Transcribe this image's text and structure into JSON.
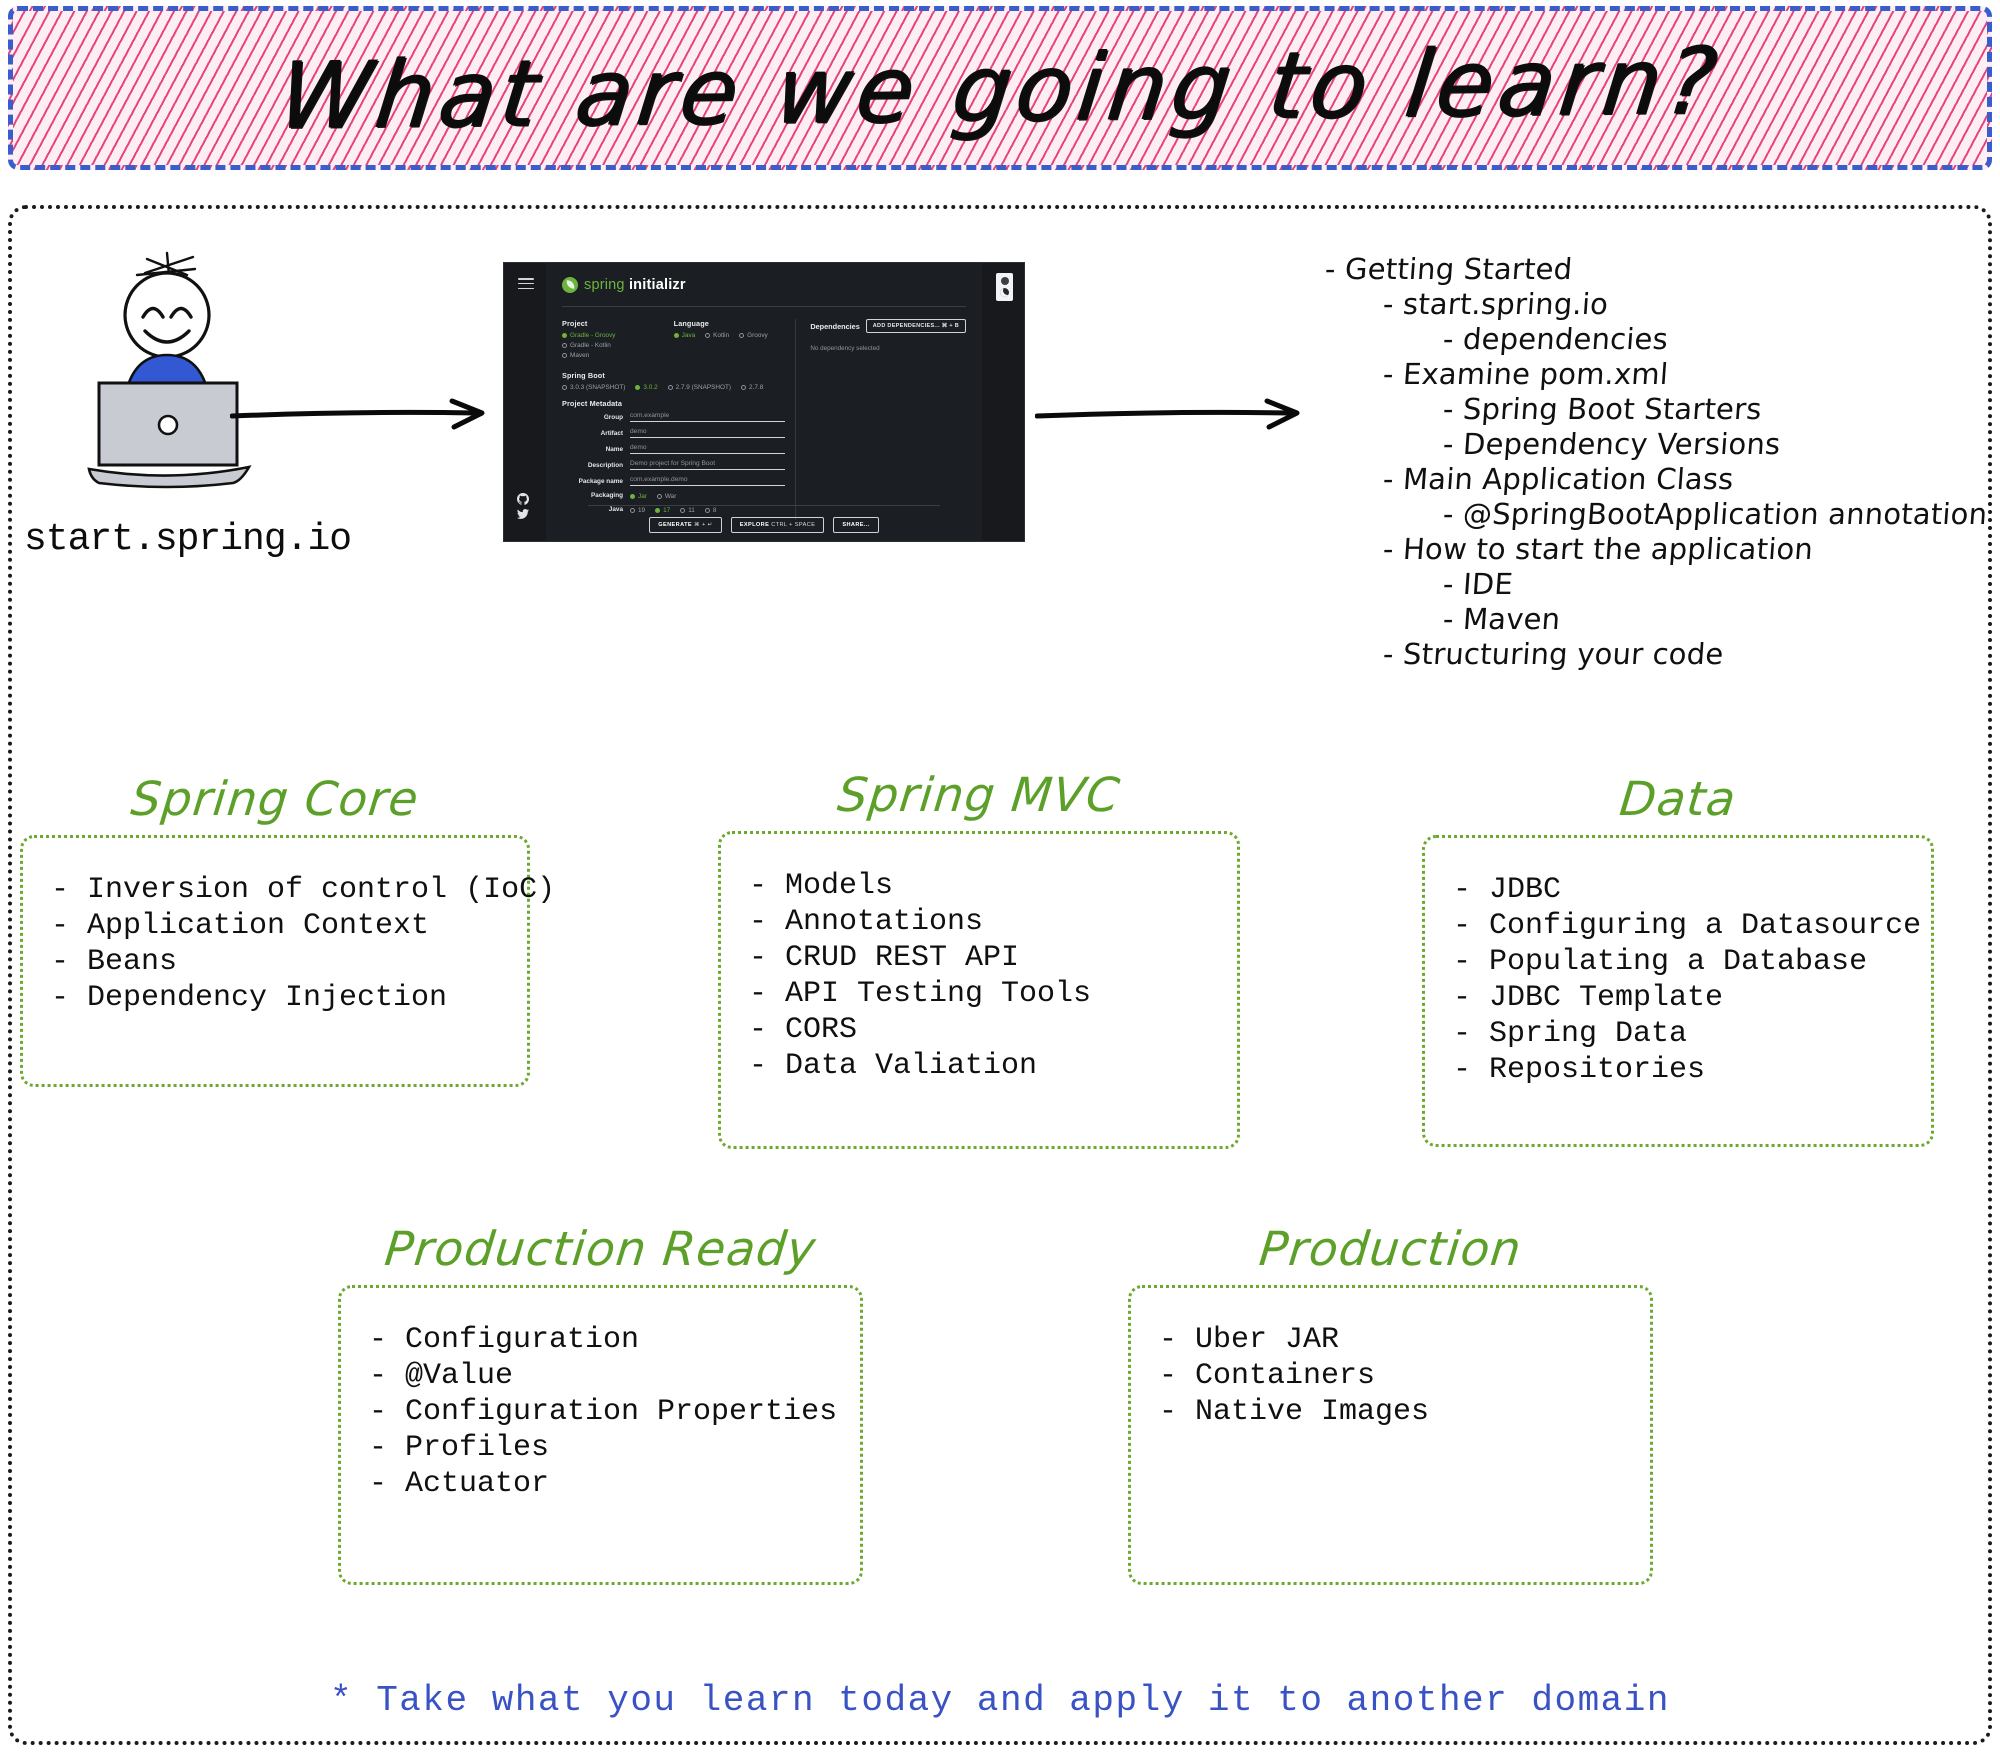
{
  "title": {
    "text": "What are we going to learn?",
    "border_color": "#3a5ccc",
    "hatch_color": "#e8457a"
  },
  "diagram": {
    "source_label": "start.spring.io",
    "person_icon": "person-at-laptop-icon",
    "arrow_1_icon": "arrow-right-icon",
    "arrow_2_icon": "arrow-right-icon"
  },
  "initializr": {
    "brand_green": "spring",
    "brand_white": "initializr",
    "menu_icon": "hamburger-menu-icon",
    "theme_toggle_icon": "theme-toggle-icon",
    "github_icon": "github-icon",
    "twitter_icon": "twitter-icon",
    "sections": {
      "project": {
        "label": "Project",
        "options": [
          {
            "label": "Gradle - Groovy",
            "selected": true
          },
          {
            "label": "Gradle - Kotlin",
            "selected": false
          },
          {
            "label": "Maven",
            "selected": false
          }
        ]
      },
      "language": {
        "label": "Language",
        "options": [
          {
            "label": "Java",
            "selected": true
          },
          {
            "label": "Kotlin",
            "selected": false
          },
          {
            "label": "Groovy",
            "selected": false
          }
        ]
      },
      "spring_boot": {
        "label": "Spring Boot",
        "options": [
          {
            "label": "3.0.3 (SNAPSHOT)",
            "selected": false
          },
          {
            "label": "3.0.2",
            "selected": true
          },
          {
            "label": "2.7.9 (SNAPSHOT)",
            "selected": false
          },
          {
            "label": "2.7.8",
            "selected": false
          }
        ]
      },
      "metadata": {
        "label": "Project Metadata",
        "fields": [
          {
            "label": "Group",
            "value": "com.example"
          },
          {
            "label": "Artifact",
            "value": "demo"
          },
          {
            "label": "Name",
            "value": "demo"
          },
          {
            "label": "Description",
            "value": "Demo project for Spring Boot"
          },
          {
            "label": "Package name",
            "value": "com.example.demo"
          }
        ],
        "packaging": {
          "label": "Packaging",
          "options": [
            {
              "label": "Jar",
              "selected": true
            },
            {
              "label": "War",
              "selected": false
            }
          ]
        },
        "java": {
          "label": "Java",
          "options": [
            {
              "label": "19",
              "selected": false
            },
            {
              "label": "17",
              "selected": true
            },
            {
              "label": "11",
              "selected": false
            },
            {
              "label": "8",
              "selected": false
            }
          ]
        }
      },
      "dependencies": {
        "label": "Dependencies",
        "add_button": "ADD DEPENDENCIES...  ⌘ + B",
        "empty_text": "No dependency selected"
      }
    },
    "footer_buttons": [
      {
        "label": "GENERATE",
        "shortcut": "⌘ + ↵"
      },
      {
        "label": "EXPLORE",
        "shortcut": "CTRL + SPACE"
      },
      {
        "label": "SHARE...",
        "shortcut": ""
      }
    ]
  },
  "outline": [
    {
      "level": 0,
      "text": "- Getting Started"
    },
    {
      "level": 1,
      "text": "- start.spring.io"
    },
    {
      "level": 2,
      "text": "- dependencies"
    },
    {
      "level": 1,
      "text": "- Examine pom.xml"
    },
    {
      "level": 2,
      "text": "- Spring Boot Starters"
    },
    {
      "level": 2,
      "text": "- Dependency Versions"
    },
    {
      "level": 1,
      "text": "- Main Application Class"
    },
    {
      "level": 2,
      "text": "- @SpringBootApplication annotation"
    },
    {
      "level": 1,
      "text": "- How to start the application"
    },
    {
      "level": 2,
      "text": "- IDE"
    },
    {
      "level": 2,
      "text": "- Maven"
    },
    {
      "level": 1,
      "text": "- Structuring your code"
    }
  ],
  "cards": [
    {
      "title": "Spring Core",
      "items": [
        "- Inversion of control (IoC)",
        "- Application Context",
        "- Beans",
        "- Dependency Injection"
      ]
    },
    {
      "title": "Spring MVC",
      "items": [
        "- Models",
        "- Annotations",
        "- CRUD REST API",
        "- API Testing Tools",
        "- CORS",
        "- Data Valiation"
      ]
    },
    {
      "title": "Data",
      "items": [
        "- JDBC",
        "- Configuring a Datasource",
        "- Populating a Database",
        "- JDBC Template",
        "- Spring Data",
        "- Repositories"
      ]
    },
    {
      "title": "Production Ready",
      "items": [
        "- Configuration",
        "- @Value",
        "- Configuration Properties",
        "- Profiles",
        "- Actuator"
      ]
    },
    {
      "title": "Production",
      "items": [
        "- Uber JAR",
        "- Containers",
        "- Native Images"
      ]
    }
  ],
  "footnote": "* Take what you learn today and apply it to another domain",
  "colors": {
    "green_heading": "#5ca02a",
    "green_border": "#6ea82e",
    "blue_footnote": "#3a53c4",
    "pink_hatch": "#e8457a",
    "blue_dash": "#3a5ccc"
  }
}
